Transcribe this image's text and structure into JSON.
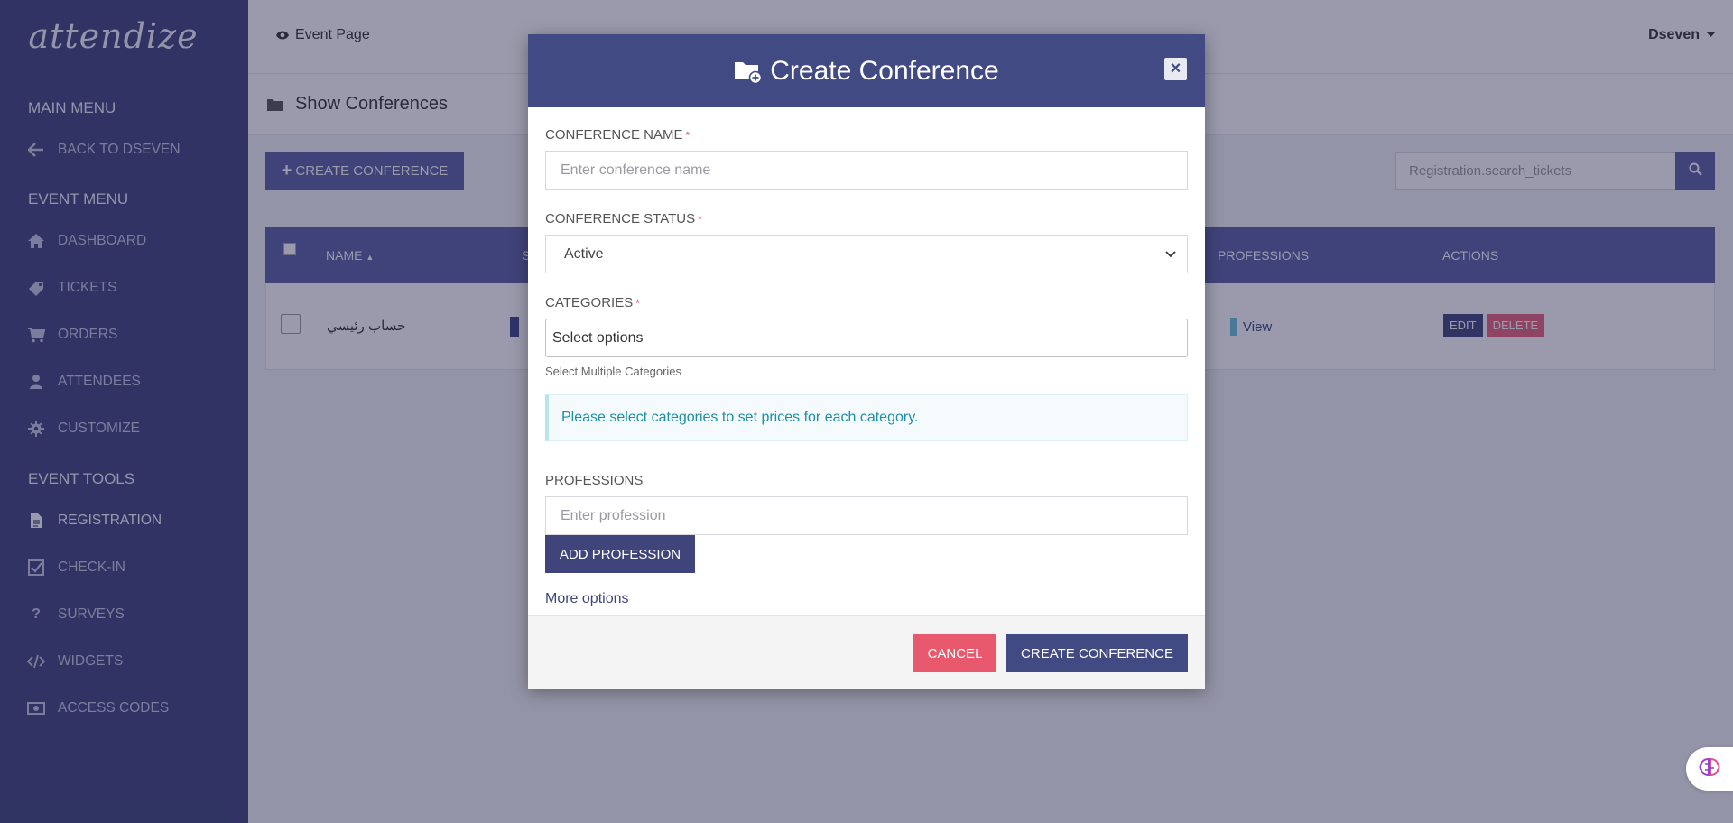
{
  "app": {
    "logo_text": "attendize"
  },
  "sidebar": {
    "main_menu_heading": "MAIN MENU",
    "main_items": [
      {
        "label": "BACK TO DSEVEN",
        "icon": "arrow-left-icon"
      }
    ],
    "event_menu_heading": "EVENT MENU",
    "event_items": [
      {
        "label": "DASHBOARD",
        "icon": "home-icon"
      },
      {
        "label": "TICKETS",
        "icon": "ticket-icon"
      },
      {
        "label": "ORDERS",
        "icon": "cart-icon"
      },
      {
        "label": "ATTENDEES",
        "icon": "user-icon"
      },
      {
        "label": "CUSTOMIZE",
        "icon": "gear-icon"
      }
    ],
    "event_tools_heading": "EVENT TOOLS",
    "tool_items": [
      {
        "label": "REGISTRATION",
        "icon": "file-icon",
        "active": true
      },
      {
        "label": "CHECK-IN",
        "icon": "checkbox-icon"
      },
      {
        "label": "SURVEYS",
        "icon": "question-icon"
      },
      {
        "label": "WIDGETS",
        "icon": "code-icon"
      },
      {
        "label": "ACCESS CODES",
        "icon": "money-icon"
      }
    ]
  },
  "topbar": {
    "event_page_label": "Event Page",
    "user_name": "Dseven"
  },
  "page": {
    "title": "Show Conferences",
    "create_button": "CREATE CONFERENCE",
    "search_placeholder": "Registration.search_tickets"
  },
  "table": {
    "headers": {
      "name": "NAME",
      "status_fragment": "S",
      "professions": "PROFESSIONS",
      "actions": "ACTIONS"
    },
    "rows": [
      {
        "name": "حساب رئيسي",
        "view_label": "View",
        "edit_label": "EDIT",
        "delete_label": "DELETE"
      }
    ]
  },
  "modal": {
    "title": "Create Conference",
    "close_symbol": "×",
    "conference_name_label": "CONFERENCE NAME",
    "conference_name_placeholder": "Enter conference name",
    "required_mark": "*",
    "conference_status_label": "CONFERENCE STATUS",
    "conference_status_value": "Active",
    "categories_label": "CATEGORIES",
    "categories_placeholder": "Select options",
    "categories_help": "Select Multiple Categories",
    "categories_info": "Please select categories to set prices for each category.",
    "professions_label": "PROFESSIONS",
    "professions_placeholder": "Enter profession",
    "add_profession_button": "ADD PROFESSION",
    "more_options_link": "More options",
    "cancel_button": "CANCEL",
    "submit_button": "CREATE CONFERENCE"
  },
  "colors": {
    "sidebar_bg": "#3f447b",
    "accent": "#5b61a4",
    "modal_header": "#424a84",
    "danger": "#e8596e",
    "info_text": "#1e8fa3"
  }
}
